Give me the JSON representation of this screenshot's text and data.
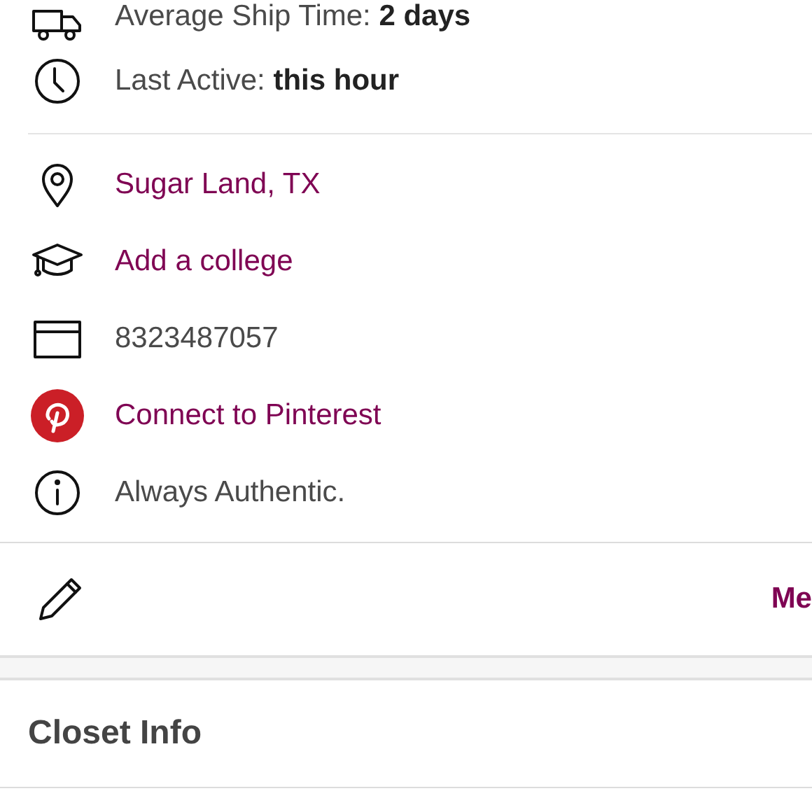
{
  "stats": [
    {
      "text": "Average Ship Time: **2 days**"
    },
    {
      "text": "Last Active: **this hour**"
    }
  ],
  "details": [
    {
      "kind": "link",
      "text": "Sugar Land, TX"
    },
    {
      "kind": "link",
      "text": "Add a college"
    },
    {
      "kind": "text",
      "text": "8323487057"
    },
    {
      "kind": "link",
      "text": "Connect to Pinterest"
    },
    {
      "kind": "text",
      "text": "Always Authentic."
    }
  ],
  "edit_row": {
    "action": "Me"
  },
  "section": {
    "title": "Closet Info"
  }
}
